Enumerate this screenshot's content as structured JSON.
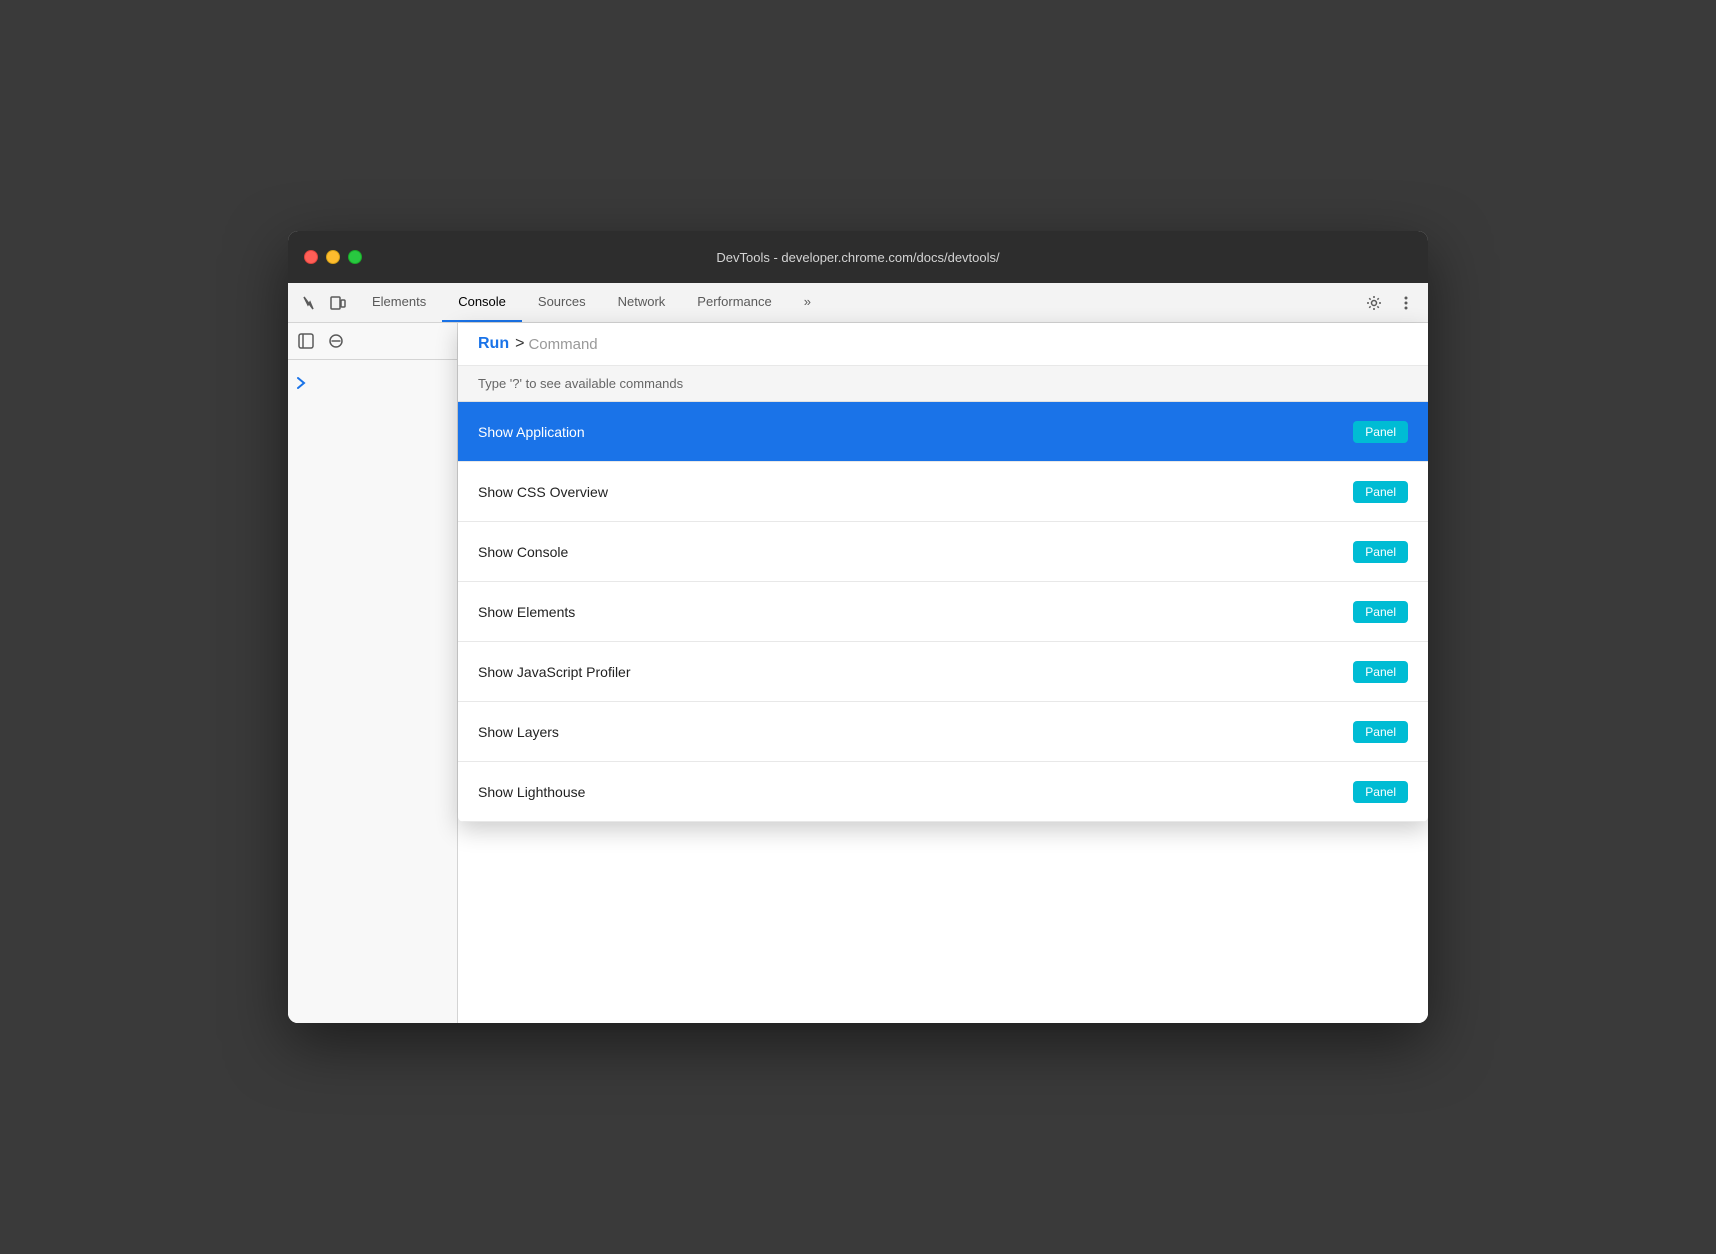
{
  "window": {
    "title": "DevTools - developer.chrome.com/docs/devtools/"
  },
  "tabs": {
    "items": [
      {
        "id": "elements",
        "label": "Elements",
        "active": false
      },
      {
        "id": "console",
        "label": "Console",
        "active": true
      },
      {
        "id": "sources",
        "label": "Sources",
        "active": false
      },
      {
        "id": "network",
        "label": "Network",
        "active": false
      },
      {
        "id": "performance",
        "label": "Performance",
        "active": false
      }
    ],
    "more_label": "»"
  },
  "command_menu": {
    "run_label": "Run",
    "gt_symbol": ">",
    "input_placeholder": "Command",
    "hint_text": "Type '?' to see available commands",
    "items": [
      {
        "id": "show-application",
        "name": "Show Application",
        "badge": "Panel",
        "selected": true
      },
      {
        "id": "show-css-overview",
        "name": "Show CSS Overview",
        "badge": "Panel",
        "selected": false
      },
      {
        "id": "show-console",
        "name": "Show Console",
        "badge": "Panel",
        "selected": false
      },
      {
        "id": "show-elements",
        "name": "Show Elements",
        "badge": "Panel",
        "selected": false
      },
      {
        "id": "show-js-profiler",
        "name": "Show JavaScript Profiler",
        "badge": "Panel",
        "selected": false
      },
      {
        "id": "show-layers",
        "name": "Show Layers",
        "badge": "Panel",
        "selected": false
      },
      {
        "id": "show-lighthouse",
        "name": "Show Lighthouse",
        "badge": "Panel",
        "selected": false
      }
    ]
  },
  "colors": {
    "tab_active_border": "#1a73e8",
    "selected_item_bg": "#1a73e8",
    "badge_bg": "#00bcd4",
    "run_label_color": "#1a73e8"
  }
}
